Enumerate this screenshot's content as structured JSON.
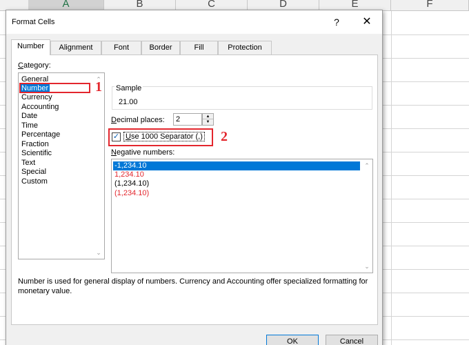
{
  "sheet": {
    "columns": [
      "A",
      "B",
      "C",
      "D",
      "E",
      "F"
    ]
  },
  "dialog": {
    "title": "Format Cells",
    "help_label": "?",
    "close_label": "✕",
    "tabs": [
      {
        "label": "Number"
      },
      {
        "label": "Alignment"
      },
      {
        "label": "Font"
      },
      {
        "label": "Border"
      },
      {
        "label": "Fill"
      },
      {
        "label": "Protection"
      }
    ],
    "category": {
      "label_prefix": "",
      "label_underlined": "C",
      "label_rest": "ategory:",
      "items": [
        "General",
        "Number",
        "Currency",
        "Accounting",
        "Date",
        "Time",
        "Percentage",
        "Fraction",
        "Scientific",
        "Text",
        "Special",
        "Custom"
      ],
      "selected": "Number"
    },
    "sample": {
      "label": "Sample",
      "value": "21.00"
    },
    "decimal_places": {
      "label_underlined": "D",
      "label_rest": "ecimal places:",
      "value": "2"
    },
    "separator": {
      "label_underlined": "U",
      "label_rest": "se 1000 Separator (,)",
      "checked": true,
      "check_glyph": "✓"
    },
    "negative_numbers": {
      "label_underlined": "N",
      "label_rest": "egative numbers:",
      "items": [
        {
          "text": "-1,234.10",
          "color": "#000000"
        },
        {
          "text": "1,234.10",
          "color": "#e3262d"
        },
        {
          "text": "(1,234.10)",
          "color": "#000000"
        },
        {
          "text": "(1,234.10)",
          "color": "#e3262d"
        }
      ],
      "selected_index": 0
    },
    "description": "Number is used for general display of numbers.  Currency and Accounting offer specialized formatting for monetary value.",
    "buttons": {
      "ok": "OK",
      "cancel": "Cancel"
    }
  },
  "annotations": {
    "step1": "1",
    "step2": "2",
    "color": "#e3262d"
  },
  "colors": {
    "selection": "#0078d7",
    "excel_green": "#217346"
  }
}
